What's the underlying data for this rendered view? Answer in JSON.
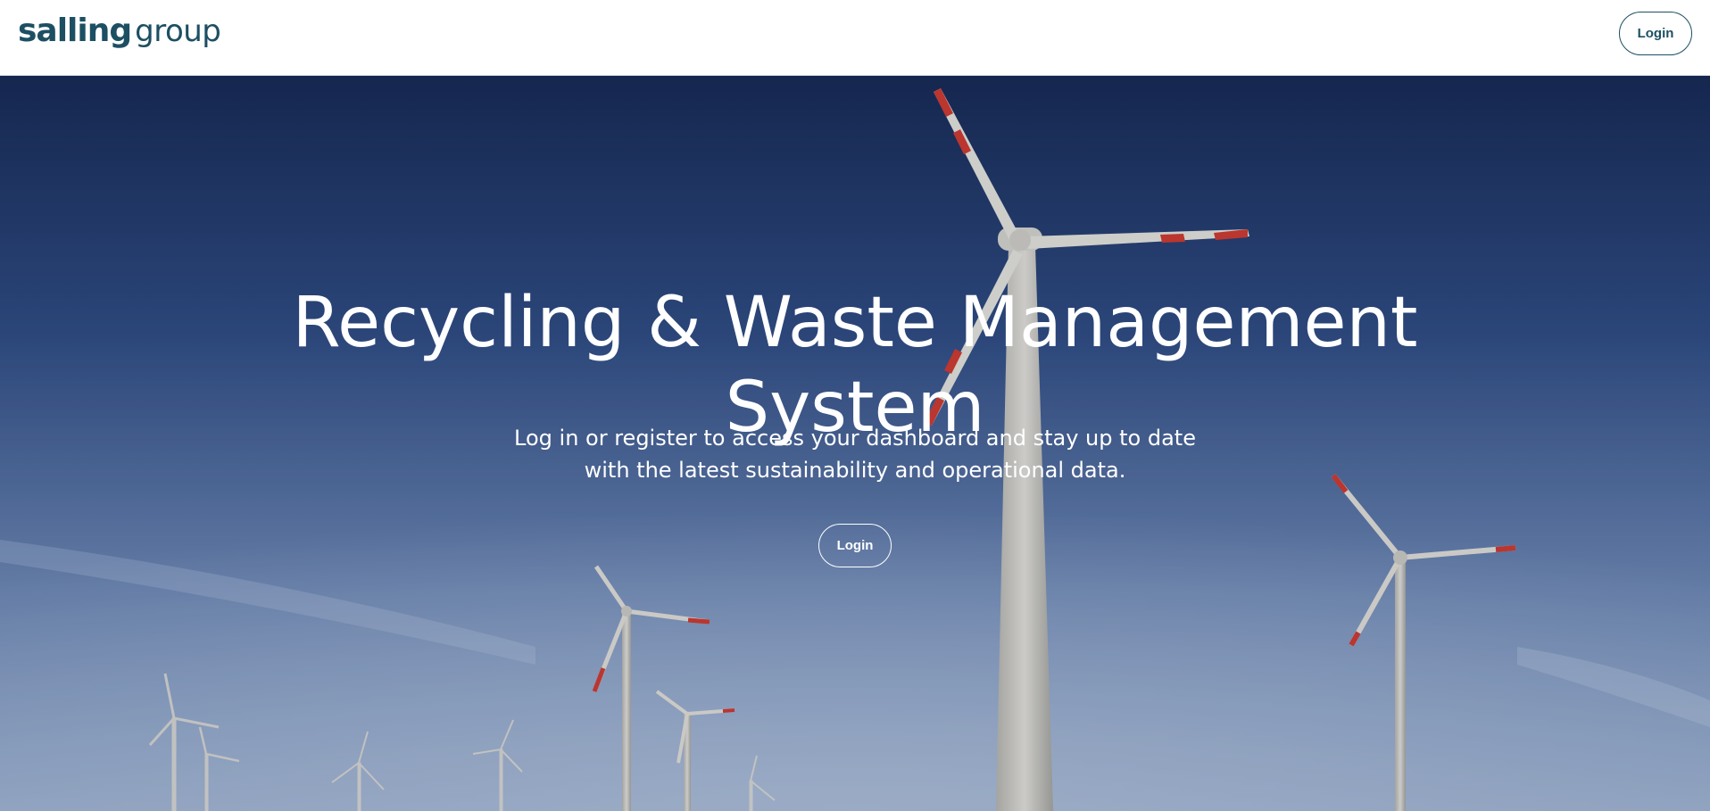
{
  "header": {
    "logo_primary": "salling",
    "logo_secondary": "group",
    "login_label": "Login"
  },
  "hero": {
    "title_line1": "Recycling & Waste Management",
    "title_line2": "System",
    "subtitle_line1": "Log in or register to access your dashboard and stay up to date",
    "subtitle_line2": "with the latest sustainability and operational data.",
    "login_label": "Login",
    "background": "wind-turbines-photo"
  },
  "colors": {
    "brand": "#1d4f63",
    "sky_top": "#172a55",
    "sky_bottom": "#8aa3c6",
    "turbine_red": "#d23a2c"
  }
}
